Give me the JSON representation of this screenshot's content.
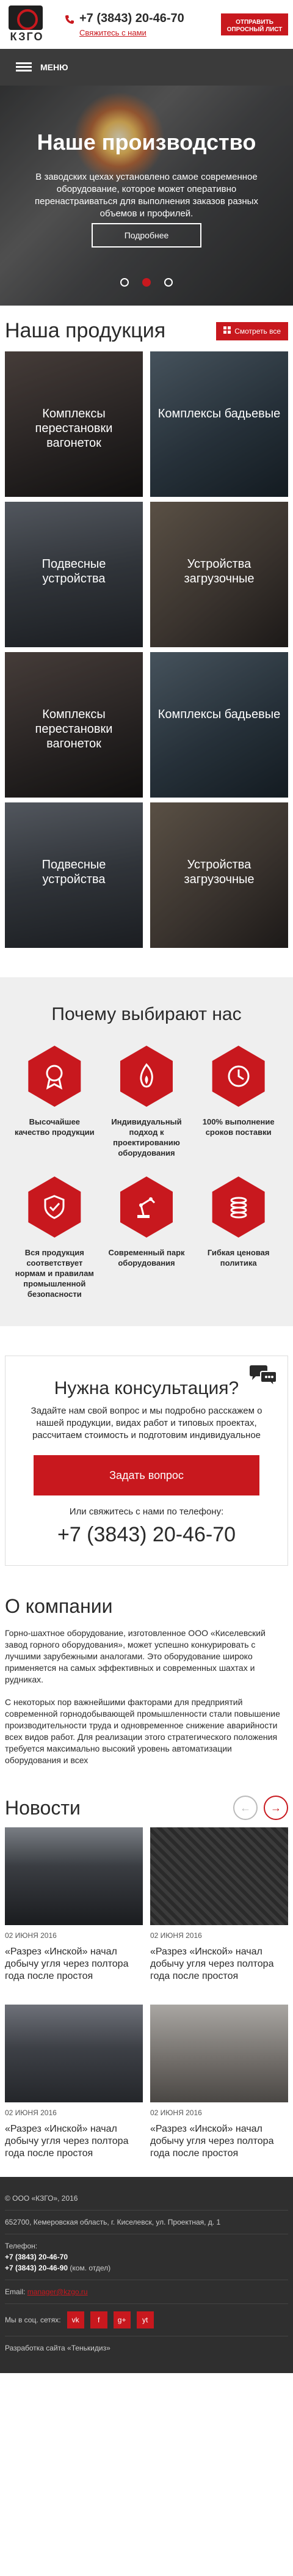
{
  "header": {
    "logo_text": "КЗГО",
    "phone": "+7 (3843) 20-46-70",
    "callback_label": "Свяжитесь с нами",
    "questionnaire_button": "ОТПРАВИТЬ ОПРОСНЫЙ ЛИСТ"
  },
  "menu": {
    "label": "МЕНЮ"
  },
  "hero": {
    "title": "Наше производство",
    "text": "В заводских цехах установлено самое современное оборудование, которое может оперативно перенастраиваться для выполнения заказов разных объемов и профилей.",
    "button_label": "Подробнее",
    "slides_count": 3,
    "active_slide": 2
  },
  "products": {
    "title": "Наша продукция",
    "view_all_label": "Смотреть все",
    "items": [
      {
        "label": "Комплексы перестановки вагонеток"
      },
      {
        "label": "Комплексы бадьевые"
      },
      {
        "label": "Подвесные устройства"
      },
      {
        "label": "Устройства загрузочные"
      },
      {
        "label": "Комплексы перестановки вагонеток"
      },
      {
        "label": "Комплексы бадьевые"
      },
      {
        "label": "Подвесные устройства"
      },
      {
        "label": "Устройства загрузочные"
      }
    ]
  },
  "why": {
    "title": "Почему выбирают нас",
    "items": [
      {
        "icon": "medal-icon",
        "label": "Высочайшее качество продукции"
      },
      {
        "icon": "flame-icon",
        "label": "Индивидуальный подход к проектированию оборудования"
      },
      {
        "icon": "clock-icon",
        "label": "100% выполнение сроков поставки"
      },
      {
        "icon": "shield-icon",
        "label": "Вся продукция соответствует нормам и правилам промышленной безопасности"
      },
      {
        "icon": "robot-arm-icon",
        "label": "Современный парк оборудования"
      },
      {
        "icon": "coins-icon",
        "label": "Гибкая ценовая политика"
      }
    ]
  },
  "consult": {
    "title": "Нужна консультация?",
    "text": "Задайте нам свой вопрос и мы подробно расскажем о нашей продукции, видах работ и типовых проектах, рассчитаем стоимость и подготовим индивидуальное",
    "button_label": "Задать вопрос",
    "or_text": "Или свяжитесь с нами по телефону:",
    "phone": "+7 (3843) 20-46-70"
  },
  "about": {
    "title": "О компании",
    "p1": "Горно-шахтное оборудование, изготовленное ООО «Киселевский завод горного оборудования», может успешно конкурировать с лучшими зарубежными аналогами. Это оборудование широко применяется на самых эффективных и современных шахтах и рудниках.",
    "p2": "С некоторых пор важнейшими факторами для предприятий современной горнодобывающей промышленности стали повышение производительности труда и одновременное снижение аварийности всех видов работ. Для реализации этого стратегического положения требуется максимально высокий уровень автоматизации оборудования и всех"
  },
  "news": {
    "title": "Новости",
    "items": [
      {
        "date": "02 ИЮНЯ 2016",
        "title": "«Разрез «Инской» начал добычу угля через полтора года после простоя"
      },
      {
        "date": "02 ИЮНЯ 2016",
        "title": "«Разрез «Инской» начал добычу угля через полтора года после простоя"
      },
      {
        "date": "02 ИЮНЯ 2016",
        "title": "«Разрез «Инской» начал добычу угля через полтора года после простоя"
      },
      {
        "date": "02 ИЮНЯ 2016",
        "title": "«Разрез «Инской» начал добычу угля через полтора года после простоя"
      }
    ]
  },
  "footer": {
    "copyright": "© ООО «КЗГО», 2016",
    "address": "652700, Кемеровская область, г. Киселевск, ул. Проектная, д. 1",
    "phone_label": "Телефон:",
    "phone1": "+7 (3843) 20-46-70",
    "phone2": "+7 (3843) 20-46-90",
    "phone2_note": "(ком. отдел)",
    "email_label": "Email:",
    "email": "manager@kzgo.ru",
    "social_label": "Мы в соц. сетях:",
    "social": [
      "vk",
      "f",
      "g+",
      "yt"
    ],
    "developer": "Разработка сайта «Тенькидиз»"
  }
}
